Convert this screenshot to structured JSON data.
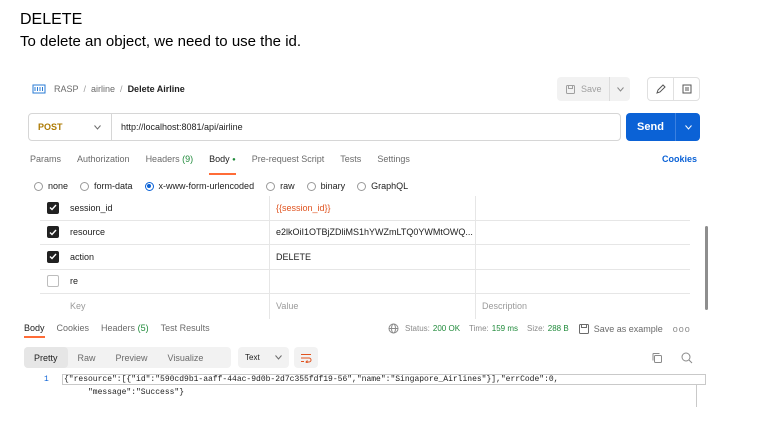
{
  "doc": {
    "heading": "DELETE",
    "text": "To delete an object, we need to use the id."
  },
  "breadcrumb": {
    "collection": "RASP",
    "folder": "airline",
    "current": "Delete Airline"
  },
  "toolbar": {
    "save_label": "Save"
  },
  "request": {
    "method": "POST",
    "url": "http://localhost:8081/api/airline",
    "send_label": "Send"
  },
  "req_tabs": {
    "params": "Params",
    "authorization": "Authorization",
    "headers": "Headers",
    "headers_count": "(9)",
    "body": "Body",
    "body_dot": "●",
    "pre_request": "Pre-request Script",
    "tests": "Tests",
    "settings": "Settings",
    "cookies": "Cookies"
  },
  "body_types": {
    "none": "none",
    "form_data": "form-data",
    "urlencoded": "x-www-form-urlencoded",
    "raw": "raw",
    "binary": "binary",
    "graphql": "GraphQL",
    "selected": "x-www-form-urlencoded"
  },
  "params": {
    "rows": [
      {
        "key": "session_id",
        "value": "{{session_id}}",
        "checked": true
      },
      {
        "key": "resource",
        "value": "e2lkOiI1OTBjZDliMS1hYWZmLTQ0YWMtOWQ...",
        "checked": true
      },
      {
        "key": "action",
        "value": "DELETE",
        "checked": true
      },
      {
        "key": "re",
        "value": "",
        "checked": false
      }
    ],
    "header_key": "Key",
    "header_value": "Value",
    "header_desc": "Description"
  },
  "response": {
    "tabs": {
      "body": "Body",
      "cookies": "Cookies",
      "headers": "Headers",
      "headers_count": "(5)",
      "test_results": "Test Results"
    },
    "status_label": "Status:",
    "status_value": "200 OK",
    "time_label": "Time:",
    "time_value": "159 ms",
    "size_label": "Size:",
    "size_value": "288 B",
    "save_example": "Save as example",
    "more": "ooo",
    "views": [
      "Pretty",
      "Raw",
      "Preview",
      "Visualize"
    ],
    "active_view": "Pretty",
    "format": "Text",
    "line_number": "1",
    "line1": "{\"resource\":[{\"id\":\"590cd9b1-aaff-44ac-9d0b-2d7c355fdf19-56\",\"name\":\"Singapore_Airlines\"}],\"errCode\":0,",
    "line2": "\"message\":\"Success\"}"
  },
  "colors": {
    "accent": "#0b62d6",
    "method_post": "#ad7a03",
    "tab_underline": "#ff6c37",
    "status_ok": "#1f8a3a",
    "variable": "#e0531f"
  }
}
